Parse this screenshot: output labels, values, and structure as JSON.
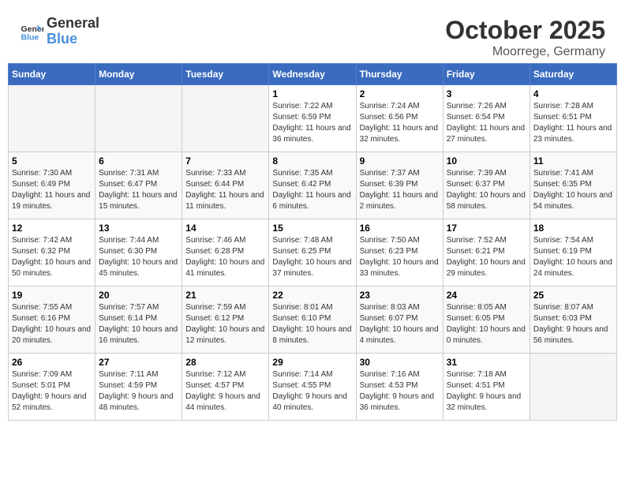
{
  "header": {
    "logo_line1": "General",
    "logo_line2": "Blue",
    "title": "October 2025",
    "subtitle": "Moorrege, Germany"
  },
  "weekdays": [
    "Sunday",
    "Monday",
    "Tuesday",
    "Wednesday",
    "Thursday",
    "Friday",
    "Saturday"
  ],
  "weeks": [
    [
      {
        "day": "",
        "sunrise": "",
        "sunset": "",
        "daylight": ""
      },
      {
        "day": "",
        "sunrise": "",
        "sunset": "",
        "daylight": ""
      },
      {
        "day": "",
        "sunrise": "",
        "sunset": "",
        "daylight": ""
      },
      {
        "day": "1",
        "sunrise": "Sunrise: 7:22 AM",
        "sunset": "Sunset: 6:59 PM",
        "daylight": "Daylight: 11 hours and 36 minutes."
      },
      {
        "day": "2",
        "sunrise": "Sunrise: 7:24 AM",
        "sunset": "Sunset: 6:56 PM",
        "daylight": "Daylight: 11 hours and 32 minutes."
      },
      {
        "day": "3",
        "sunrise": "Sunrise: 7:26 AM",
        "sunset": "Sunset: 6:54 PM",
        "daylight": "Daylight: 11 hours and 27 minutes."
      },
      {
        "day": "4",
        "sunrise": "Sunrise: 7:28 AM",
        "sunset": "Sunset: 6:51 PM",
        "daylight": "Daylight: 11 hours and 23 minutes."
      }
    ],
    [
      {
        "day": "5",
        "sunrise": "Sunrise: 7:30 AM",
        "sunset": "Sunset: 6:49 PM",
        "daylight": "Daylight: 11 hours and 19 minutes."
      },
      {
        "day": "6",
        "sunrise": "Sunrise: 7:31 AM",
        "sunset": "Sunset: 6:47 PM",
        "daylight": "Daylight: 11 hours and 15 minutes."
      },
      {
        "day": "7",
        "sunrise": "Sunrise: 7:33 AM",
        "sunset": "Sunset: 6:44 PM",
        "daylight": "Daylight: 11 hours and 11 minutes."
      },
      {
        "day": "8",
        "sunrise": "Sunrise: 7:35 AM",
        "sunset": "Sunset: 6:42 PM",
        "daylight": "Daylight: 11 hours and 6 minutes."
      },
      {
        "day": "9",
        "sunrise": "Sunrise: 7:37 AM",
        "sunset": "Sunset: 6:39 PM",
        "daylight": "Daylight: 11 hours and 2 minutes."
      },
      {
        "day": "10",
        "sunrise": "Sunrise: 7:39 AM",
        "sunset": "Sunset: 6:37 PM",
        "daylight": "Daylight: 10 hours and 58 minutes."
      },
      {
        "day": "11",
        "sunrise": "Sunrise: 7:41 AM",
        "sunset": "Sunset: 6:35 PM",
        "daylight": "Daylight: 10 hours and 54 minutes."
      }
    ],
    [
      {
        "day": "12",
        "sunrise": "Sunrise: 7:42 AM",
        "sunset": "Sunset: 6:32 PM",
        "daylight": "Daylight: 10 hours and 50 minutes."
      },
      {
        "day": "13",
        "sunrise": "Sunrise: 7:44 AM",
        "sunset": "Sunset: 6:30 PM",
        "daylight": "Daylight: 10 hours and 45 minutes."
      },
      {
        "day": "14",
        "sunrise": "Sunrise: 7:46 AM",
        "sunset": "Sunset: 6:28 PM",
        "daylight": "Daylight: 10 hours and 41 minutes."
      },
      {
        "day": "15",
        "sunrise": "Sunrise: 7:48 AM",
        "sunset": "Sunset: 6:25 PM",
        "daylight": "Daylight: 10 hours and 37 minutes."
      },
      {
        "day": "16",
        "sunrise": "Sunrise: 7:50 AM",
        "sunset": "Sunset: 6:23 PM",
        "daylight": "Daylight: 10 hours and 33 minutes."
      },
      {
        "day": "17",
        "sunrise": "Sunrise: 7:52 AM",
        "sunset": "Sunset: 6:21 PM",
        "daylight": "Daylight: 10 hours and 29 minutes."
      },
      {
        "day": "18",
        "sunrise": "Sunrise: 7:54 AM",
        "sunset": "Sunset: 6:19 PM",
        "daylight": "Daylight: 10 hours and 24 minutes."
      }
    ],
    [
      {
        "day": "19",
        "sunrise": "Sunrise: 7:55 AM",
        "sunset": "Sunset: 6:16 PM",
        "daylight": "Daylight: 10 hours and 20 minutes."
      },
      {
        "day": "20",
        "sunrise": "Sunrise: 7:57 AM",
        "sunset": "Sunset: 6:14 PM",
        "daylight": "Daylight: 10 hours and 16 minutes."
      },
      {
        "day": "21",
        "sunrise": "Sunrise: 7:59 AM",
        "sunset": "Sunset: 6:12 PM",
        "daylight": "Daylight: 10 hours and 12 minutes."
      },
      {
        "day": "22",
        "sunrise": "Sunrise: 8:01 AM",
        "sunset": "Sunset: 6:10 PM",
        "daylight": "Daylight: 10 hours and 8 minutes."
      },
      {
        "day": "23",
        "sunrise": "Sunrise: 8:03 AM",
        "sunset": "Sunset: 6:07 PM",
        "daylight": "Daylight: 10 hours and 4 minutes."
      },
      {
        "day": "24",
        "sunrise": "Sunrise: 8:05 AM",
        "sunset": "Sunset: 6:05 PM",
        "daylight": "Daylight: 10 hours and 0 minutes."
      },
      {
        "day": "25",
        "sunrise": "Sunrise: 8:07 AM",
        "sunset": "Sunset: 6:03 PM",
        "daylight": "Daylight: 9 hours and 56 minutes."
      }
    ],
    [
      {
        "day": "26",
        "sunrise": "Sunrise: 7:09 AM",
        "sunset": "Sunset: 5:01 PM",
        "daylight": "Daylight: 9 hours and 52 minutes."
      },
      {
        "day": "27",
        "sunrise": "Sunrise: 7:11 AM",
        "sunset": "Sunset: 4:59 PM",
        "daylight": "Daylight: 9 hours and 48 minutes."
      },
      {
        "day": "28",
        "sunrise": "Sunrise: 7:12 AM",
        "sunset": "Sunset: 4:57 PM",
        "daylight": "Daylight: 9 hours and 44 minutes."
      },
      {
        "day": "29",
        "sunrise": "Sunrise: 7:14 AM",
        "sunset": "Sunset: 4:55 PM",
        "daylight": "Daylight: 9 hours and 40 minutes."
      },
      {
        "day": "30",
        "sunrise": "Sunrise: 7:16 AM",
        "sunset": "Sunset: 4:53 PM",
        "daylight": "Daylight: 9 hours and 36 minutes."
      },
      {
        "day": "31",
        "sunrise": "Sunrise: 7:18 AM",
        "sunset": "Sunset: 4:51 PM",
        "daylight": "Daylight: 9 hours and 32 minutes."
      },
      {
        "day": "",
        "sunrise": "",
        "sunset": "",
        "daylight": ""
      }
    ]
  ]
}
